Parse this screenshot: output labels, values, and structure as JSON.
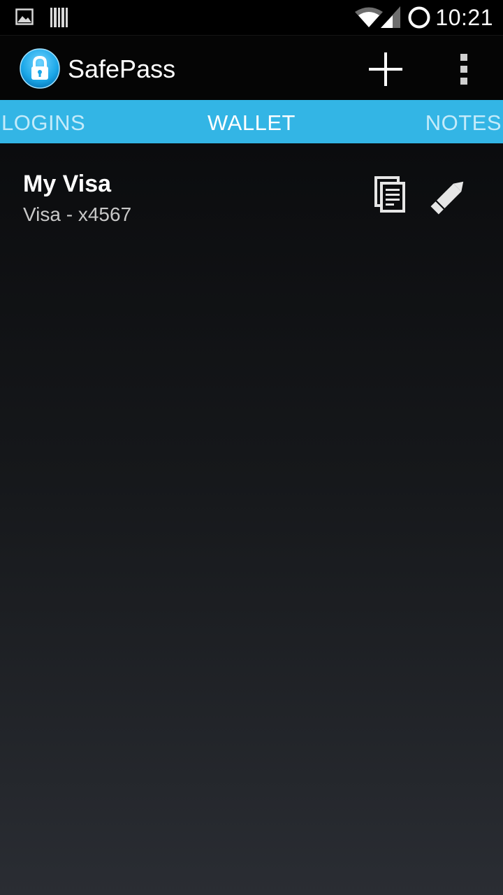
{
  "status_bar": {
    "time": "10:21",
    "left_icons": [
      "gallery-icon",
      "barcode-icon"
    ],
    "right_icons": [
      "wifi-icon",
      "signal-icon",
      "sync-circle-icon"
    ]
  },
  "action_bar": {
    "title": "SafePass",
    "logo_icon": "lock-icon",
    "actions": [
      "add-icon",
      "overflow-menu-icon"
    ]
  },
  "tabs": [
    {
      "label": "LOGINS",
      "selected": false
    },
    {
      "label": "WALLET",
      "selected": true
    },
    {
      "label": "NOTES",
      "selected": false
    }
  ],
  "wallet_items": [
    {
      "title": "My Visa",
      "subtitle": "Visa - x4567",
      "actions": [
        "copy-icon",
        "pencil-icon"
      ]
    }
  ],
  "colors": {
    "accent": "#33b5e5",
    "inactive_tab_text": "#c4ebfa",
    "background_top": "#0b0c0e",
    "background_bottom": "#2a2d33"
  }
}
